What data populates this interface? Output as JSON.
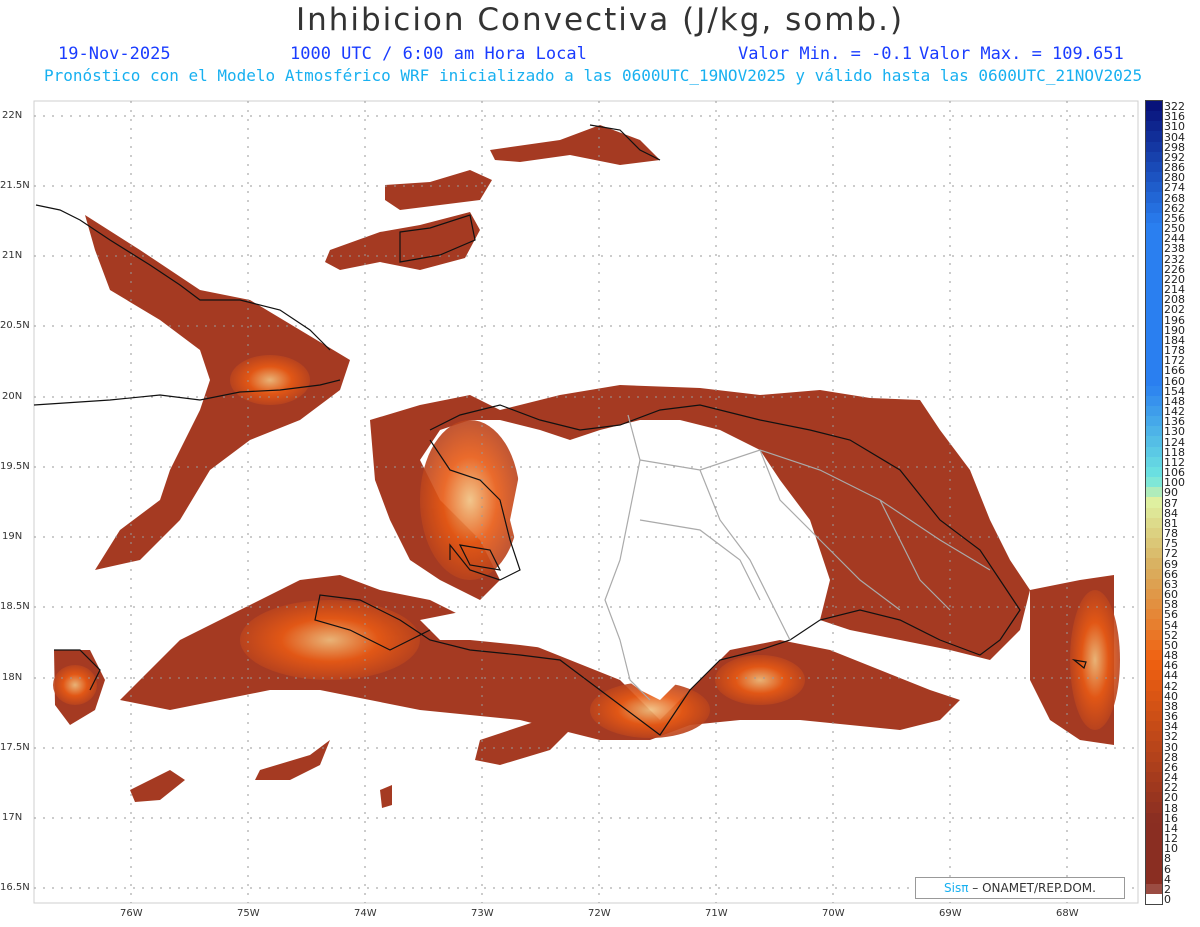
{
  "title": "Inhibicion Convectiva (J/kg, somb.)",
  "header": {
    "date": "19-Nov-2025",
    "time": "1000 UTC / 6:00 am Hora Local",
    "min_label": "Valor Min. = -0.1",
    "max_label": "Valor Max. = 109.651",
    "forecast_line": "Pronóstico con el Modelo Atmosférico WRF inicializado a las 0600UTC_19NOV2025 y válido hasta las  0600UTC_21NOV2025"
  },
  "axes": {
    "lat_labels": [
      "22N",
      "21.5N",
      "21N",
      "20.5N",
      "20N",
      "19.5N",
      "19N",
      "18.5N",
      "18N",
      "17.5N",
      "17N",
      "16.5N"
    ],
    "lon_labels": [
      "76W",
      "75W",
      "74W",
      "73W",
      "72W",
      "71W",
      "70W",
      "69W",
      "68W"
    ]
  },
  "colorbar": {
    "labels": [
      "322",
      "316",
      "310",
      "304",
      "298",
      "292",
      "286",
      "280",
      "274",
      "268",
      "262",
      "256",
      "250",
      "244",
      "238",
      "232",
      "226",
      "220",
      "214",
      "208",
      "202",
      "196",
      "190",
      "184",
      "178",
      "172",
      "166",
      "160",
      "154",
      "148",
      "142",
      "136",
      "130",
      "124",
      "118",
      "112",
      "106",
      "100",
      "90",
      "87",
      "84",
      "81",
      "78",
      "75",
      "72",
      "69",
      "66",
      "63",
      "60",
      "58",
      "56",
      "54",
      "52",
      "50",
      "48",
      "46",
      "44",
      "42",
      "40",
      "38",
      "36",
      "34",
      "32",
      "30",
      "28",
      "26",
      "24",
      "22",
      "20",
      "18",
      "16",
      "14",
      "12",
      "10",
      "8",
      "6",
      "4",
      "2",
      "0"
    ],
    "colors": {
      "high": "#08127a",
      "mid_blue": "#2a7ff0",
      "cyan": "#6fe6e0",
      "light_green": "#dff0a0",
      "tan": "#d9b060",
      "orange": "#f06010",
      "brown": "#8a2e22",
      "zero": "#ffffff"
    }
  },
  "credit": {
    "sis": "Sisπ",
    "rest": "– ONAMET/REP.DOM."
  },
  "map_colors": {
    "field": "#a53a22",
    "field_hot": "#e85a14",
    "field_light": "#f0c080",
    "coast": "#111111",
    "border": "#aaaaaa"
  }
}
